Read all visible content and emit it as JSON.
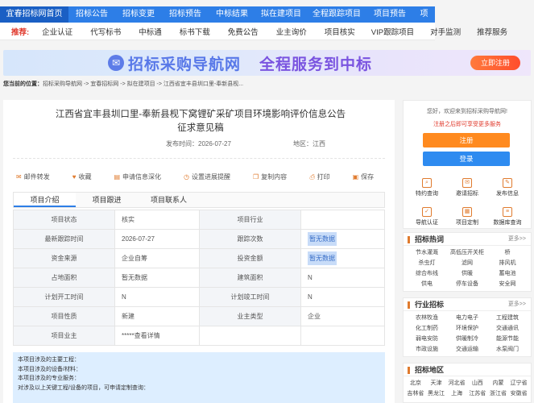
{
  "nav": [
    "宜春招标网首页",
    "招标公告",
    "招标变更",
    "招标预告",
    "中标结果",
    "拟在建项目",
    "全程跟踪项目",
    "项目预告",
    "项"
  ],
  "subnav": {
    "label": "推荐:",
    "items": [
      "企业认证",
      "代写标书",
      "中标通",
      "标书下载",
      "免费公告",
      "业主询价",
      "项目核实",
      "VIP跟踪项目",
      "对手监测",
      "推荐服务"
    ]
  },
  "banner": {
    "text1": "招标采购导航网",
    "text2": "全程服务到中标",
    "btn": "立即注册"
  },
  "breadcrumb": {
    "label": "您当前的位置：",
    "path": "招标采购导航网 -> 宜春招标网 -> 拟在建项目 -> 江西省宜丰县圳口里-奉新县枧..."
  },
  "article": {
    "title": "江西省宜丰县圳口里-奉新县枧下窝锂矿采矿项目环境影响评价信息公告征求意见稿",
    "publish_label": "发布时间：",
    "publish_date": "2026-07-27",
    "region_label": "地区：",
    "region": "江西"
  },
  "tools": [
    "邮件转发",
    "收藏",
    "申请信息深化",
    "设置进展提醒",
    "复制内容",
    "打印",
    "保存"
  ],
  "tabs": [
    "项目介绍",
    "项目跟进",
    "项目联系人"
  ],
  "table": [
    [
      "项目状态",
      "核实",
      "项目行业",
      ""
    ],
    [
      "最新跟踪时间",
      "2026-07-27",
      "跟踪次数",
      "暂无数据"
    ],
    [
      "资金来源",
      "企业自筹",
      "投资金额",
      "暂无数据"
    ],
    [
      "占地面积",
      "暂无数据",
      "建筑面积",
      "N"
    ],
    [
      "计划开工时间",
      "N",
      "计划竣工时间",
      "N"
    ],
    [
      "项目性质",
      "新建",
      "业主类型",
      "企业"
    ],
    [
      "项目业主",
      "*****查看详情",
      "",
      ""
    ]
  ],
  "notice": [
    "本项目涉及的主要工程：",
    "本项目涉及的设备/材料：",
    "本项目涉及的专业服务：",
    "对涉及以上关键工程/设备的项目，可申请定制查询："
  ],
  "login": {
    "welcome": "您好，欢迎来到招标采购导航网!",
    "register_tip": "注册之后即可享受更多服务",
    "register": "注册",
    "login": "登录"
  },
  "quick": [
    {
      "label": "特约查询",
      "icon": "search-icon"
    },
    {
      "label": "邀请招标",
      "icon": "invite-icon"
    },
    {
      "label": "发布信息",
      "icon": "publish-icon"
    },
    {
      "label": "导航认证",
      "icon": "certify-icon"
    },
    {
      "label": "项目定制",
      "icon": "custom-icon"
    },
    {
      "label": "数据库查询",
      "icon": "database-icon"
    }
  ],
  "hot": {
    "title": "招标热词",
    "more": "更多>>",
    "items": [
      "节水灌溉",
      "高低压开关柜",
      "桥",
      "杀虫灯",
      "滤网",
      "排风机",
      "综合布线",
      "供暖",
      "蓄电池",
      "供电",
      "停车设备",
      "安全网"
    ]
  },
  "industry": {
    "title": "行业招标",
    "more": "更多>>",
    "items": [
      "农林牧渔",
      "电力电子",
      "工程建筑",
      "化工制药",
      "环境保护",
      "交通通讯",
      "弱电安防",
      "供暖制冷",
      "能源节能",
      "市政设施",
      "交通运输",
      "水泵阀门"
    ]
  },
  "region": {
    "title": "招标地区",
    "items": [
      "北京",
      "天津",
      "河北省",
      "山西",
      "内蒙",
      "辽宁省",
      "吉林省",
      "黑龙江",
      "上海",
      "江苏省",
      "浙江省",
      "安徽省"
    ]
  }
}
